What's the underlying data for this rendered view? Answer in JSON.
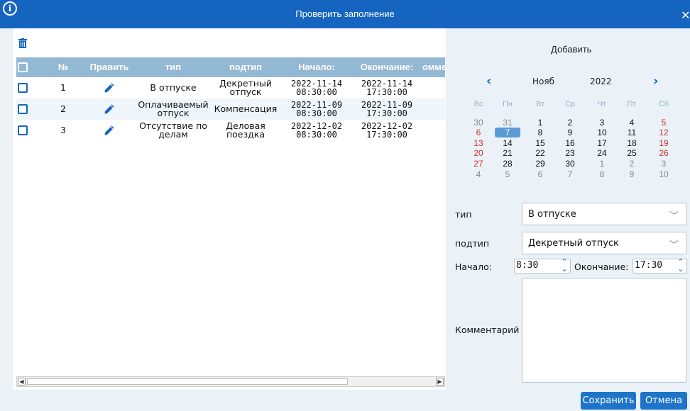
{
  "window": {
    "title": "Проверить заполнение",
    "info_icon": "info-icon",
    "close_icon": "close-icon",
    "title_bg": "#1565c0"
  },
  "grid": {
    "headers": {
      "number": "№",
      "edit": "Править",
      "type": "тип",
      "subtype": "подтип",
      "start": "Начало:",
      "end": "Окончание:",
      "comment": "омме"
    },
    "rows": [
      {
        "number": "1",
        "type": "В отпуске",
        "subtype": "Декретный отпуск",
        "start": "2022-11-14 08:30:00",
        "end": "2022-11-14 17:30:00"
      },
      {
        "number": "2",
        "type": "Оплачиваемый отпуск",
        "subtype": "Компенсация",
        "start": "2022-11-09 08:30:00",
        "end": "2022-11-09 17:30:00"
      },
      {
        "number": "3",
        "type": "Отсутствие по делам",
        "subtype": "Деловая поездка",
        "start": "2022-12-02 08:30:00",
        "end": "2022-12-02 17:30:00"
      }
    ],
    "header_bg": "#93b8d4",
    "row_alt_bg": "#eef5fb"
  },
  "form": {
    "add_label": "Добавить",
    "calendar": {
      "month": "Нояб",
      "year": "2022",
      "prev_icon": "chevron-left-icon",
      "next_icon": "chevron-right-icon",
      "weekdays": [
        "Вс",
        "Пн",
        "Вт",
        "Ср",
        "Чт",
        "Пт",
        "Сб"
      ],
      "weeks": [
        [
          "30",
          "31",
          "1",
          "2",
          "3",
          "4",
          "5"
        ],
        [
          "6",
          "7",
          "8",
          "9",
          "10",
          "11",
          "12"
        ],
        [
          "13",
          "14",
          "15",
          "16",
          "17",
          "18",
          "19"
        ],
        [
          "20",
          "21",
          "22",
          "23",
          "24",
          "25",
          "26"
        ],
        [
          "27",
          "28",
          "29",
          "30",
          "1",
          "2",
          "3"
        ],
        [
          "4",
          "5",
          "6",
          "7",
          "8",
          "9",
          "10"
        ]
      ],
      "selected_day": "7"
    },
    "type_label": "тип",
    "type_value": "В отпуске",
    "subtype_label": "подтип",
    "subtype_value": "Декретный отпуск",
    "start_label": "Начало:",
    "start_value": "8:30",
    "end_label": "Окончание:",
    "end_value": "17:30",
    "comment_label": "Комментарий",
    "save_label": "Сохранить",
    "cancel_label": "Отмена",
    "accent": "#1e74c9"
  }
}
